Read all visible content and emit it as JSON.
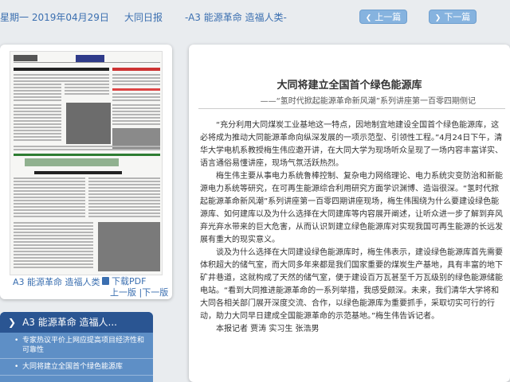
{
  "header": {
    "date": "星期一 2019年04月29日",
    "paper_name": "大同日报",
    "section": "-A3 能源革命 造福人类-",
    "prev_label": "上一篇",
    "next_label": "下一篇"
  },
  "thumbnail": {
    "label": "A3 能源革命 造福人类",
    "pdf_label": "下载PDF",
    "prev_page": "上一版",
    "separator": " |",
    "next_page": "下一版"
  },
  "sidebar": {
    "heading": "A3 能源革命 造福人...",
    "items": [
      {
        "label": "专家热议平价上网应提高项目经济性和可靠性"
      },
      {
        "label": "大同将建立全国首个绿色能源库"
      }
    ]
  },
  "article": {
    "title": "大同将建立全国首个绿色能源库",
    "subtitle": "——“氢时代掀起能源革命新风潮”系列讲座第一百零四期侧记",
    "paragraphs": [
      "“充分利用大同煤炭工业基地这一特点，因地制宜地建设全国首个绿色能源库，这必将成为推动大同能源革命向纵深发展的一项示范型、引领性工程。”4月24日下午，清华大学电机系教授梅生伟应邀开讲，在大同大学为现场听众呈现了一场内容丰富详实、语言通俗易懂讲座，现场气氛活跃热烈。",
      "梅生伟主要从事电力系统鲁棒控制、复杂电力网络理论、电力系统灾变防治和新能源电力系统等研究，在可再生能源综合利用研究方面学识渊博、造诣很深。“氢时代掀起能源革命新风潮”系列讲座第一百零四期讲座现场，梅生伟围绕为什么要建设绿色能源库、如何建库以及为什么选择在大同建库等内容展开阐述，让听众进一步了解到弃风弃光弃水带来的巨大危害，从而认识到建立绿色能源库对实现我国可再生能源的长远发展有重大的现实意义。",
      "谈及为什么选择在大同建设绿色能源库时，梅生伟表示，建设绿色能源库首先需要体积超大的储气室，而大同多年来都是我们国家重要的煤炭生产基地，具有丰富的地下矿井巷道，这就构成了天然的储气室，便于建设百万瓦甚至千万瓦级别的绿色能源储能电站。“看到大同推进能源革命的一系列举措，我感受颇深。未来，我们清华大学将和大同各相关部门展开深度交流、合作，以绿色能源库为重要抓手，采取切实可行的行动，助力大同早日建成全国能源革命的示范基地。”梅生伟告诉记者。",
      "本报记者 贾涛 实习生 张浩男"
    ]
  }
}
